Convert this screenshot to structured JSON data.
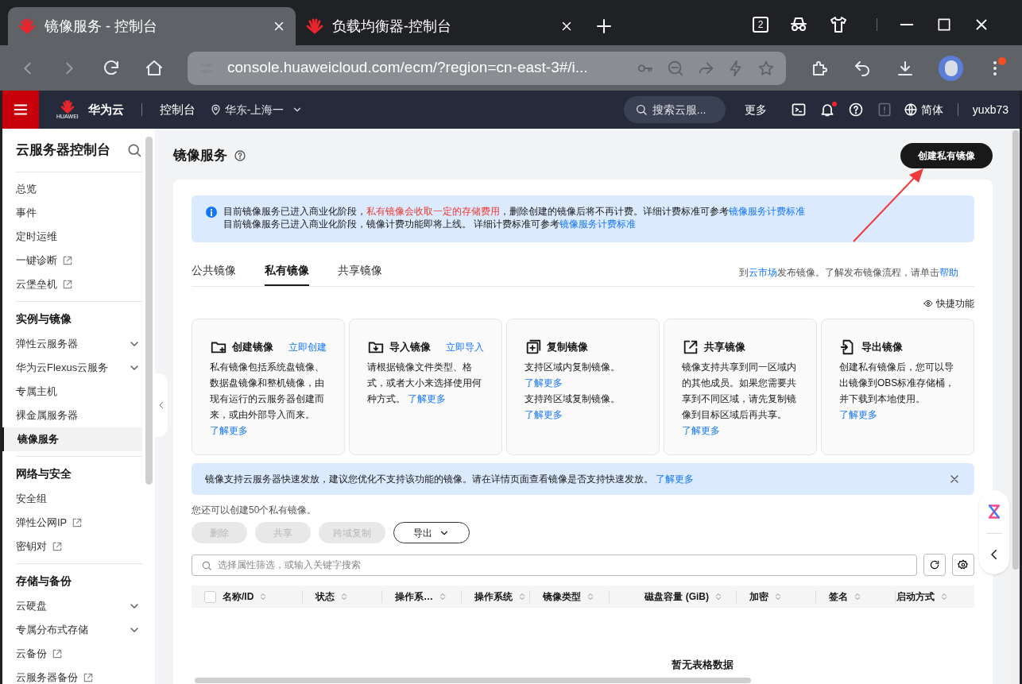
{
  "browser": {
    "tabs": [
      {
        "title": "镜像服务 - 控制台",
        "selected": true
      },
      {
        "title": "负载均衡器-控制台",
        "selected": false
      }
    ],
    "tab_count": "2",
    "url": "console.huaweicloud.com/ecm/?region=cn-east-3#/i...",
    "has_notification": true
  },
  "header": {
    "brand": "华为云",
    "brand_small": "HUAWEI",
    "console": "控制台",
    "region": "华东-上海一",
    "search_placeholder": "搜索云服...",
    "more": "更多",
    "notification_dot": true,
    "language": "简体",
    "user": "yuxb73"
  },
  "sidebar": {
    "title": "云服务器控制台",
    "groups": [
      {
        "items": [
          {
            "label": "总览",
            "external": false,
            "expandable": false,
            "selected": false
          },
          {
            "label": "事件",
            "external": false,
            "expandable": false,
            "selected": false
          },
          {
            "label": "定时运维",
            "external": false,
            "expandable": false,
            "selected": false
          },
          {
            "label": "一键诊断",
            "external": true,
            "expandable": false,
            "selected": false
          },
          {
            "label": "云堡垒机",
            "external": true,
            "expandable": false,
            "selected": false
          }
        ]
      },
      {
        "heading": "实例与镜像",
        "items": [
          {
            "label": "弹性云服务器",
            "external": false,
            "expandable": true,
            "selected": false
          },
          {
            "label": "华为云Flexus云服务",
            "external": false,
            "expandable": true,
            "selected": false
          },
          {
            "label": "专属主机",
            "external": false,
            "expandable": false,
            "selected": false
          },
          {
            "label": "裸金属服务器",
            "external": false,
            "expandable": false,
            "selected": false
          },
          {
            "label": "镜像服务",
            "external": false,
            "expandable": false,
            "selected": true
          }
        ]
      },
      {
        "heading": "网络与安全",
        "items": [
          {
            "label": "安全组",
            "external": false,
            "expandable": false,
            "selected": false
          },
          {
            "label": "弹性公网IP",
            "external": true,
            "expandable": false,
            "selected": false
          },
          {
            "label": "密钥对",
            "external": true,
            "expandable": false,
            "selected": false
          }
        ]
      },
      {
        "heading": "存储与备份",
        "items": [
          {
            "label": "云硬盘",
            "external": false,
            "expandable": true,
            "selected": false
          },
          {
            "label": "专属分布式存储",
            "external": false,
            "expandable": true,
            "selected": false
          },
          {
            "label": "云备份",
            "external": true,
            "expandable": false,
            "selected": false
          },
          {
            "label": "云服务器备份",
            "external": true,
            "expandable": false,
            "selected": false
          }
        ]
      }
    ]
  },
  "page": {
    "title": "镜像服务",
    "create_button": "创建私有镜像",
    "notice": [
      [
        {
          "kind": "plain",
          "text": "目前镜像服务已进入商业化阶段，"
        },
        {
          "kind": "warn",
          "text": "私有镜像会收取一定的存储费用"
        },
        {
          "kind": "plain",
          "text": "，删除创建的镜像后将不再计费。详细计费标准可参考"
        },
        {
          "kind": "link",
          "text": "镜像服务计费标准"
        }
      ],
      [
        {
          "kind": "plain",
          "text": "目前镜像服务已进入商业化阶段，镜像计费功能即将上线。 详细计费标准可参考"
        },
        {
          "kind": "link",
          "text": "镜像服务计费标准"
        }
      ]
    ],
    "tabs": [
      {
        "label": "公共镜像",
        "selected": false
      },
      {
        "label": "私有镜像",
        "selected": true
      },
      {
        "label": "共享镜像",
        "selected": false
      }
    ],
    "tab_hint": [
      {
        "kind": "plain",
        "text": "到"
      },
      {
        "kind": "link",
        "text": "云市场"
      },
      {
        "kind": "plain",
        "text": "发布镜像。了解发布镜像流程，请单击"
      },
      {
        "kind": "link",
        "text": "帮助"
      }
    ],
    "quick_functions": "快捷功能",
    "features": [
      {
        "kind": "create",
        "title": "创建镜像",
        "action": "立即创建",
        "body": [
          [
            {
              "kind": "plain",
              "text": "私有镜像包括系统盘镜像、数据盘镜像和整机镜像，由现有运行的云服务器创建而来，或由外部导入而来。 "
            },
            {
              "kind": "link",
              "text": "了解更多"
            }
          ]
        ]
      },
      {
        "kind": "import",
        "title": "导入镜像",
        "action": "立即导入",
        "body": [
          [
            {
              "kind": "plain",
              "text": "请根据镜像文件类型、格式，或者大小来选择使用何种方式。 "
            },
            {
              "kind": "link",
              "text": "了解更多"
            }
          ]
        ]
      },
      {
        "kind": "copy",
        "title": "复制镜像",
        "body": [
          [
            {
              "kind": "plain",
              "text": "支持区域内复制镜像。 "
            },
            {
              "kind": "link",
              "text": "了解更多"
            }
          ],
          [
            {
              "kind": "plain",
              "text": "支持跨区域复制镜像。 "
            },
            {
              "kind": "link",
              "text": "了解更多"
            }
          ]
        ]
      },
      {
        "kind": "share",
        "title": "共享镜像",
        "body": [
          [
            {
              "kind": "plain",
              "text": "镜像支持共享到同一区域内的其他成员。如果您需要共享到不同区域，请先复制镜像到目标区域后再共享。 "
            },
            {
              "kind": "link",
              "text": "了解更多"
            }
          ]
        ]
      },
      {
        "kind": "export",
        "title": "导出镜像",
        "body": [
          [
            {
              "kind": "plain",
              "text": "创建私有镜像后，您可以导出镜像到OBS标准存储桶，并下载到本地使用。 "
            },
            {
              "kind": "link",
              "text": "了解更多"
            }
          ]
        ]
      }
    ],
    "tip": [
      {
        "kind": "plain",
        "text": "镜像支持云服务器快速发放，建议您优化不支持该功能的镜像。请在详情页面查看镜像是否支持快速发放。 "
      },
      {
        "kind": "link",
        "text": "了解更多"
      }
    ],
    "quota": "您还可以创建50个私有镜像。",
    "actions": [
      {
        "label": "删除",
        "disabled": true
      },
      {
        "label": "共享",
        "disabled": true
      },
      {
        "label": "跨域复制",
        "disabled": true
      }
    ],
    "export": "导出",
    "filter_placeholder": "选择属性筛选，或输入关键字搜索",
    "select_all_checked": false,
    "columns": [
      {
        "label": "名称/ID"
      },
      {
        "label": "状态"
      },
      {
        "label": "操作系…"
      },
      {
        "label": "操作系统"
      },
      {
        "label": "镜像类型"
      },
      {
        "label": "磁盘容量 (GiB)"
      },
      {
        "label": "加密"
      },
      {
        "label": "签名"
      },
      {
        "label": "启动方式"
      }
    ],
    "empty_text": "暂无表格数据"
  }
}
